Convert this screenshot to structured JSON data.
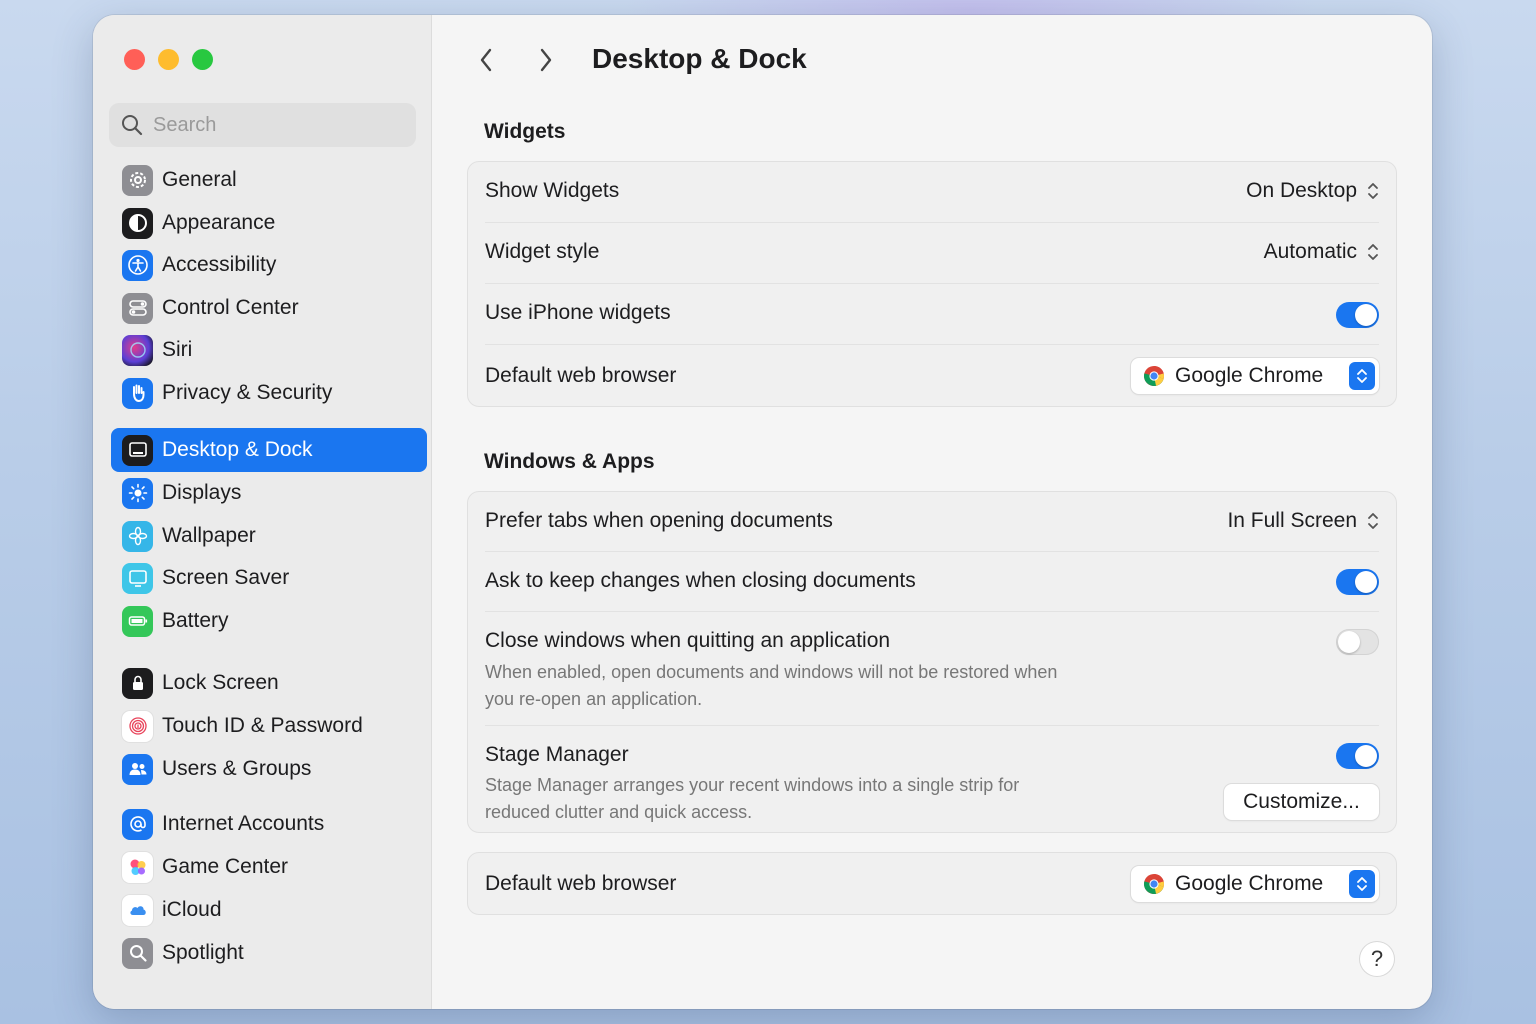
{
  "window": {
    "title": "Desktop & Dock"
  },
  "search": {
    "placeholder": "Search"
  },
  "sidebar": {
    "items": [
      {
        "label": "General",
        "icon": "gear-icon"
      },
      {
        "label": "Appearance",
        "icon": "appearance-icon"
      },
      {
        "label": "Accessibility",
        "icon": "accessibility-icon"
      },
      {
        "label": "Control Center",
        "icon": "control-center-icon"
      },
      {
        "label": "Siri",
        "icon": "siri-icon"
      },
      {
        "label": "Privacy & Security",
        "icon": "hand-icon"
      },
      {
        "label": "Desktop & Dock",
        "icon": "desktop-dock-icon",
        "selected": true
      },
      {
        "label": "Displays",
        "icon": "displays-icon"
      },
      {
        "label": "Wallpaper",
        "icon": "wallpaper-icon"
      },
      {
        "label": "Screen Saver",
        "icon": "screen-saver-icon"
      },
      {
        "label": "Battery",
        "icon": "battery-icon"
      },
      {
        "label": "Lock Screen",
        "icon": "lock-icon"
      },
      {
        "label": "Touch ID & Password",
        "icon": "fingerprint-icon"
      },
      {
        "label": "Users & Groups",
        "icon": "users-icon"
      },
      {
        "label": "Internet Accounts",
        "icon": "at-icon"
      },
      {
        "label": "Game Center",
        "icon": "game-center-icon"
      },
      {
        "label": "iCloud",
        "icon": "icloud-icon"
      },
      {
        "label": "Spotlight",
        "icon": "spotlight-icon"
      }
    ]
  },
  "widgets": {
    "title": "Widgets",
    "show_widgets_label": "Show Widgets",
    "show_widgets_value": "On Desktop",
    "widget_style_label": "Widget style",
    "widget_style_value": "Automatic",
    "iphone_widgets_label": "Use iPhone widgets",
    "iphone_widgets_on": true,
    "browser_label": "Default web browser",
    "browser_value": "Google Chrome"
  },
  "windows_apps": {
    "title": "Windows & Apps",
    "prefer_tabs_label": "Prefer tabs when opening documents",
    "prefer_tabs_value": "In Full Screen",
    "ask_keep_label": "Ask to keep changes when closing documents",
    "ask_keep_on": true,
    "close_windows_label": "Close windows when quitting an application",
    "close_windows_sub_1": "When enabled, open documents and windows will not be restored when",
    "close_windows_sub_2": "you re-open an application.",
    "close_windows_on": false,
    "stage_manager_label": "Stage Manager",
    "stage_manager_sub_1": "Stage Manager arranges your recent windows into a single strip for",
    "stage_manager_sub_2": "reduced clutter and quick access.",
    "stage_manager_on": true,
    "customize_label": "Customize..."
  },
  "bottom": {
    "browser_label": "Default web browser",
    "browser_value": "Google Chrome"
  },
  "help": {
    "label": "?"
  },
  "colors": {
    "accent": "#1a76f0",
    "close": "#ff5f57",
    "minimize": "#febc2e",
    "zoom": "#28c840"
  }
}
